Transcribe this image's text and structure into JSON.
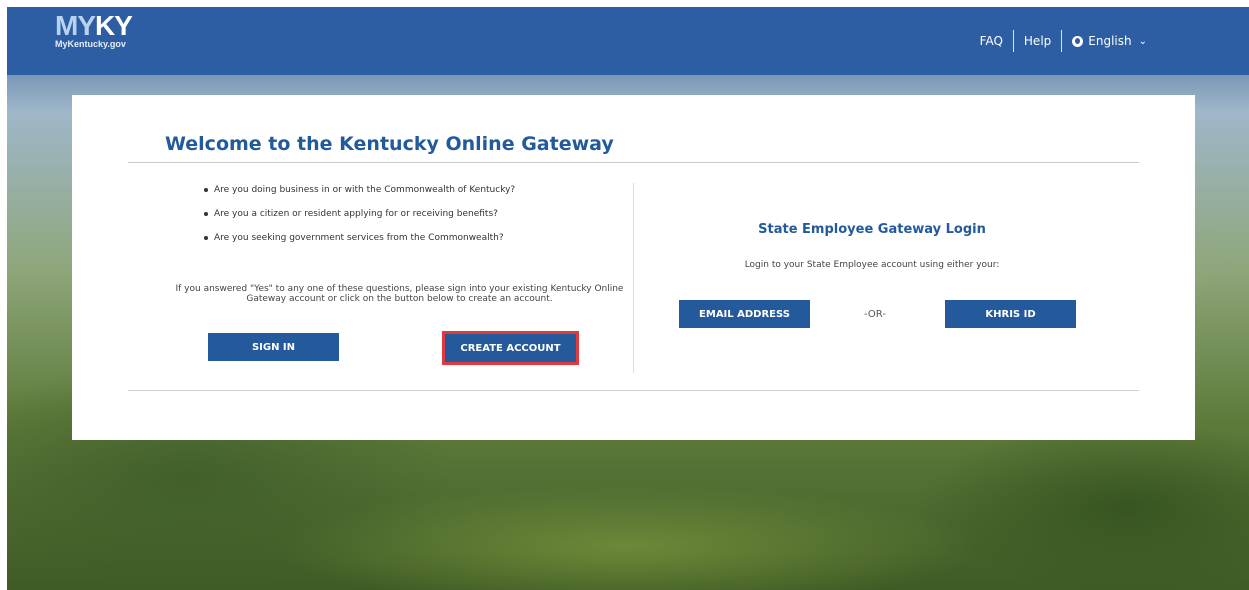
{
  "header": {
    "logo_main_my": "MY",
    "logo_main_ky": "KY",
    "logo_sub": "MyKentucky.gov",
    "nav": {
      "faq": "FAQ",
      "help": "Help",
      "language": "English",
      "language_icon": "globe-icon",
      "language_chevron": "chevron-down-icon"
    }
  },
  "welcome": {
    "title": "Welcome to the Kentucky Online Gateway",
    "questions": [
      "Are you doing business in or with the Commonwealth of Kentucky?",
      "Are you a citizen or resident applying for or receiving benefits?",
      "Are you seeking government services from the Commonwealth?"
    ],
    "answer_text": "If you answered \"Yes\" to any one of these questions, please sign into your existing Kentucky Online Gateway account or click on the button below to create an account.",
    "sign_in_label": "SIGN IN",
    "create_account_label": "CREATE ACCOUNT"
  },
  "state_employee": {
    "title": "State Employee Gateway Login",
    "description": "Login to your State Employee account using either your:",
    "email_label": "EMAIL ADDRESS",
    "or_label": "-OR-",
    "khris_label": "KHRIS ID"
  },
  "colors": {
    "header_blue": "#2d5ea3",
    "button_blue": "#245a9c",
    "title_blue": "#225a9c",
    "highlight_red": "#e03a3e"
  }
}
